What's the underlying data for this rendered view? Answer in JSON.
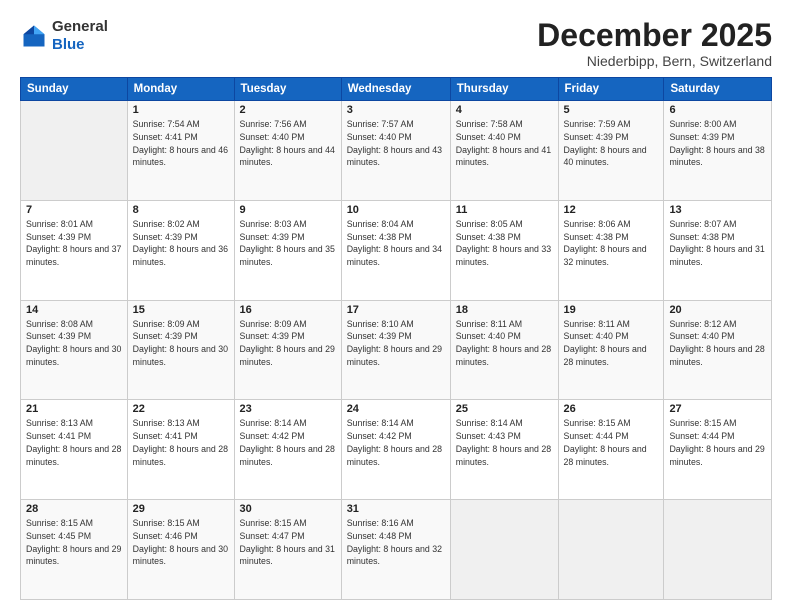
{
  "header": {
    "logo_general": "General",
    "logo_blue": "Blue",
    "month_title": "December 2025",
    "location": "Niederbipp, Bern, Switzerland"
  },
  "weekdays": [
    "Sunday",
    "Monday",
    "Tuesday",
    "Wednesday",
    "Thursday",
    "Friday",
    "Saturday"
  ],
  "weeks": [
    [
      {
        "day": "",
        "sunrise": "",
        "sunset": "",
        "daylight": ""
      },
      {
        "day": "1",
        "sunrise": "Sunrise: 7:54 AM",
        "sunset": "Sunset: 4:41 PM",
        "daylight": "Daylight: 8 hours and 46 minutes."
      },
      {
        "day": "2",
        "sunrise": "Sunrise: 7:56 AM",
        "sunset": "Sunset: 4:40 PM",
        "daylight": "Daylight: 8 hours and 44 minutes."
      },
      {
        "day": "3",
        "sunrise": "Sunrise: 7:57 AM",
        "sunset": "Sunset: 4:40 PM",
        "daylight": "Daylight: 8 hours and 43 minutes."
      },
      {
        "day": "4",
        "sunrise": "Sunrise: 7:58 AM",
        "sunset": "Sunset: 4:40 PM",
        "daylight": "Daylight: 8 hours and 41 minutes."
      },
      {
        "day": "5",
        "sunrise": "Sunrise: 7:59 AM",
        "sunset": "Sunset: 4:39 PM",
        "daylight": "Daylight: 8 hours and 40 minutes."
      },
      {
        "day": "6",
        "sunrise": "Sunrise: 8:00 AM",
        "sunset": "Sunset: 4:39 PM",
        "daylight": "Daylight: 8 hours and 38 minutes."
      }
    ],
    [
      {
        "day": "7",
        "sunrise": "Sunrise: 8:01 AM",
        "sunset": "Sunset: 4:39 PM",
        "daylight": "Daylight: 8 hours and 37 minutes."
      },
      {
        "day": "8",
        "sunrise": "Sunrise: 8:02 AM",
        "sunset": "Sunset: 4:39 PM",
        "daylight": "Daylight: 8 hours and 36 minutes."
      },
      {
        "day": "9",
        "sunrise": "Sunrise: 8:03 AM",
        "sunset": "Sunset: 4:39 PM",
        "daylight": "Daylight: 8 hours and 35 minutes."
      },
      {
        "day": "10",
        "sunrise": "Sunrise: 8:04 AM",
        "sunset": "Sunset: 4:38 PM",
        "daylight": "Daylight: 8 hours and 34 minutes."
      },
      {
        "day": "11",
        "sunrise": "Sunrise: 8:05 AM",
        "sunset": "Sunset: 4:38 PM",
        "daylight": "Daylight: 8 hours and 33 minutes."
      },
      {
        "day": "12",
        "sunrise": "Sunrise: 8:06 AM",
        "sunset": "Sunset: 4:38 PM",
        "daylight": "Daylight: 8 hours and 32 minutes."
      },
      {
        "day": "13",
        "sunrise": "Sunrise: 8:07 AM",
        "sunset": "Sunset: 4:38 PM",
        "daylight": "Daylight: 8 hours and 31 minutes."
      }
    ],
    [
      {
        "day": "14",
        "sunrise": "Sunrise: 8:08 AM",
        "sunset": "Sunset: 4:39 PM",
        "daylight": "Daylight: 8 hours and 30 minutes."
      },
      {
        "day": "15",
        "sunrise": "Sunrise: 8:09 AM",
        "sunset": "Sunset: 4:39 PM",
        "daylight": "Daylight: 8 hours and 30 minutes."
      },
      {
        "day": "16",
        "sunrise": "Sunrise: 8:09 AM",
        "sunset": "Sunset: 4:39 PM",
        "daylight": "Daylight: 8 hours and 29 minutes."
      },
      {
        "day": "17",
        "sunrise": "Sunrise: 8:10 AM",
        "sunset": "Sunset: 4:39 PM",
        "daylight": "Daylight: 8 hours and 29 minutes."
      },
      {
        "day": "18",
        "sunrise": "Sunrise: 8:11 AM",
        "sunset": "Sunset: 4:40 PM",
        "daylight": "Daylight: 8 hours and 28 minutes."
      },
      {
        "day": "19",
        "sunrise": "Sunrise: 8:11 AM",
        "sunset": "Sunset: 4:40 PM",
        "daylight": "Daylight: 8 hours and 28 minutes."
      },
      {
        "day": "20",
        "sunrise": "Sunrise: 8:12 AM",
        "sunset": "Sunset: 4:40 PM",
        "daylight": "Daylight: 8 hours and 28 minutes."
      }
    ],
    [
      {
        "day": "21",
        "sunrise": "Sunrise: 8:13 AM",
        "sunset": "Sunset: 4:41 PM",
        "daylight": "Daylight: 8 hours and 28 minutes."
      },
      {
        "day": "22",
        "sunrise": "Sunrise: 8:13 AM",
        "sunset": "Sunset: 4:41 PM",
        "daylight": "Daylight: 8 hours and 28 minutes."
      },
      {
        "day": "23",
        "sunrise": "Sunrise: 8:14 AM",
        "sunset": "Sunset: 4:42 PM",
        "daylight": "Daylight: 8 hours and 28 minutes."
      },
      {
        "day": "24",
        "sunrise": "Sunrise: 8:14 AM",
        "sunset": "Sunset: 4:42 PM",
        "daylight": "Daylight: 8 hours and 28 minutes."
      },
      {
        "day": "25",
        "sunrise": "Sunrise: 8:14 AM",
        "sunset": "Sunset: 4:43 PM",
        "daylight": "Daylight: 8 hours and 28 minutes."
      },
      {
        "day": "26",
        "sunrise": "Sunrise: 8:15 AM",
        "sunset": "Sunset: 4:44 PM",
        "daylight": "Daylight: 8 hours and 28 minutes."
      },
      {
        "day": "27",
        "sunrise": "Sunrise: 8:15 AM",
        "sunset": "Sunset: 4:44 PM",
        "daylight": "Daylight: 8 hours and 29 minutes."
      }
    ],
    [
      {
        "day": "28",
        "sunrise": "Sunrise: 8:15 AM",
        "sunset": "Sunset: 4:45 PM",
        "daylight": "Daylight: 8 hours and 29 minutes."
      },
      {
        "day": "29",
        "sunrise": "Sunrise: 8:15 AM",
        "sunset": "Sunset: 4:46 PM",
        "daylight": "Daylight: 8 hours and 30 minutes."
      },
      {
        "day": "30",
        "sunrise": "Sunrise: 8:15 AM",
        "sunset": "Sunset: 4:47 PM",
        "daylight": "Daylight: 8 hours and 31 minutes."
      },
      {
        "day": "31",
        "sunrise": "Sunrise: 8:16 AM",
        "sunset": "Sunset: 4:48 PM",
        "daylight": "Daylight: 8 hours and 32 minutes."
      },
      {
        "day": "",
        "sunrise": "",
        "sunset": "",
        "daylight": ""
      },
      {
        "day": "",
        "sunrise": "",
        "sunset": "",
        "daylight": ""
      },
      {
        "day": "",
        "sunrise": "",
        "sunset": "",
        "daylight": ""
      }
    ]
  ]
}
